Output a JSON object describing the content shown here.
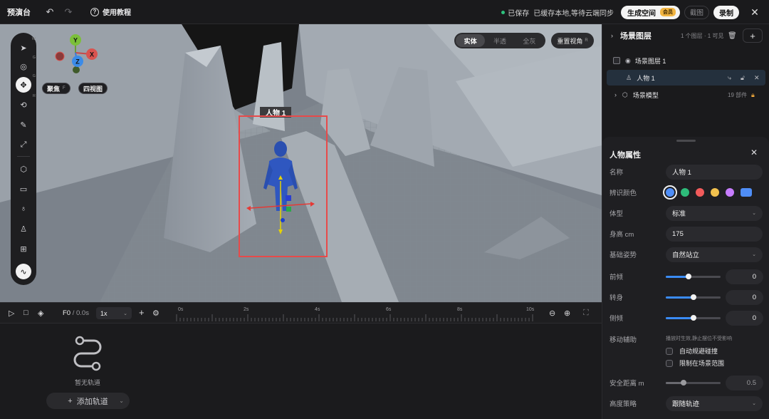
{
  "topbar": {
    "brand": "预演台",
    "undo_icon": "undo-icon",
    "redo_icon": "redo-icon",
    "help_label": "使用教程",
    "saved_label": "已保存",
    "sync_status": "已缓存本地,等待云端同步",
    "generate_label": "生成空间",
    "vip_badge": "会员",
    "screenshot_label": "截图",
    "record_label": "录制",
    "status_color": "#2ec27e"
  },
  "viewport": {
    "focus_label": "聚焦",
    "focus_key": "F",
    "quad_view_label": "四视图",
    "render_modes": [
      "实体",
      "半透",
      "全灰"
    ],
    "active_render_mode": "实体",
    "reset_view_label": "重置视角",
    "reset_view_key": "R",
    "character_label": "人物 1",
    "axis_labels": {
      "x": "X",
      "y": "Y",
      "z": "Z"
    },
    "tools": [
      {
        "icon": "select-arrow-icon",
        "key": "W"
      },
      {
        "icon": "orbit-icon",
        "key": "G"
      },
      {
        "icon": "move-icon",
        "key": "G"
      },
      {
        "icon": "rotate-icon",
        "key": "R"
      },
      {
        "icon": "pen-icon",
        "key": ""
      },
      {
        "icon": "scale-icon",
        "key": ""
      },
      {
        "icon": "cube-icon",
        "key": ""
      },
      {
        "icon": "camera-icon",
        "key": ""
      },
      {
        "icon": "light-icon",
        "key": ""
      },
      {
        "icon": "person-icon",
        "key": ""
      },
      {
        "icon": "import-icon",
        "key": ""
      },
      {
        "icon": "path-icon",
        "key": ""
      }
    ]
  },
  "timeline": {
    "frame": "F0",
    "time": "/ 0.0s",
    "speed": "1x",
    "ruler_labels": [
      "0s",
      "2s",
      "4s",
      "6s",
      "8s",
      "10s"
    ],
    "empty_text": "暂无轨道",
    "add_track_label": "添加轨道"
  },
  "layers": {
    "title": "场景图层",
    "meta": "1 个图层 · 1 可见",
    "items": [
      {
        "label": "场景图层 1",
        "count": ""
      },
      {
        "label": "人物 1",
        "count": ""
      },
      {
        "label": "场景模型",
        "count": "19 部件"
      }
    ]
  },
  "properties": {
    "title": "人物属性",
    "name_label": "名称",
    "name_value": "人物 1",
    "color_label": "辨识颜色",
    "colors": [
      "#4f8ef7",
      "#2ebc7a",
      "#f25b5b",
      "#f2c14e",
      "#c77dff",
      "#4f8ef7"
    ],
    "body_type_label": "体型",
    "body_type_value": "标准",
    "height_label": "身高 cm",
    "height_value": "175",
    "pose_label": "基础姿势",
    "pose_value": "自然站立",
    "lean_label": "前倾",
    "lean_value": "0",
    "lean_fraction": 0.42,
    "turn_label": "转身",
    "turn_value": "0",
    "turn_fraction": 0.5,
    "tilt_label": "侧倾",
    "tilt_value": "0",
    "tilt_fraction": 0.5,
    "motion_label": "移动辅助",
    "motion_hint": "播放时生效,静止摆位不受影响",
    "avoid_label": "自动规避碰撞",
    "bound_label": "限制在场景范围",
    "safe_dist_label": "安全距离 m",
    "safe_dist_value": "0.5",
    "safe_dist_fraction": 0.32,
    "height_strategy_label": "高度策略",
    "height_strategy_value": "跟随轨迹"
  }
}
